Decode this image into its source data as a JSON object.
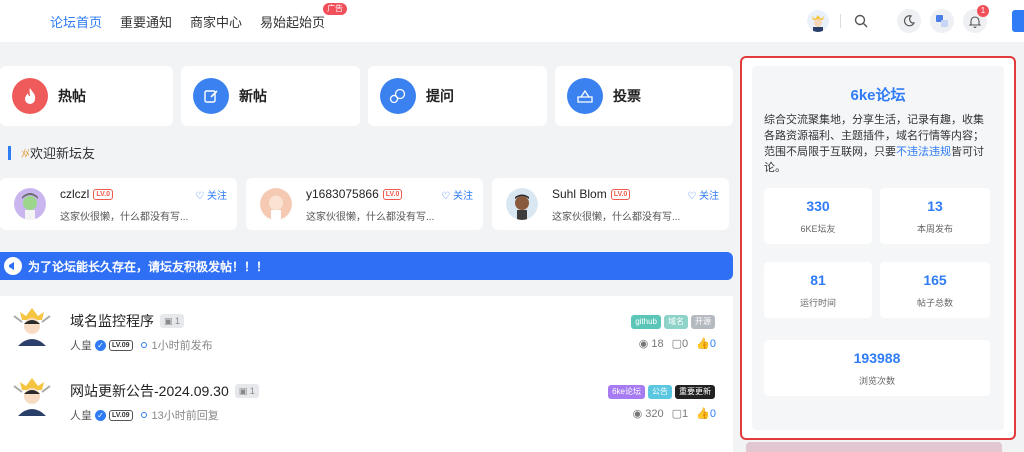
{
  "nav": {
    "items": [
      {
        "label": "论坛首页",
        "active": true
      },
      {
        "label": "重要通知",
        "active": false
      },
      {
        "label": "商家中心",
        "active": false
      },
      {
        "label": "易始起始页",
        "active": false
      }
    ],
    "ad_badge": "广告"
  },
  "header": {
    "icons": [
      "search-icon",
      "moon-icon",
      "translate-icon",
      "bell-icon"
    ],
    "bell_count": "1"
  },
  "quick_actions": [
    {
      "label": "热帖",
      "icon": "fire-icon",
      "color": "#ef5a5a"
    },
    {
      "label": "新帖",
      "icon": "edit-icon",
      "color": "#3b82f0"
    },
    {
      "label": "提问",
      "icon": "question-icon",
      "color": "#3b82f0"
    },
    {
      "label": "投票",
      "icon": "vote-icon",
      "color": "#3b82f0"
    }
  ],
  "welcome": {
    "title": "欢迎新坛友",
    "members": [
      {
        "name": "czlczl",
        "level": "LV.0",
        "bio": "这家伙很懒，什么都没有写...",
        "follow": "关注"
      },
      {
        "name": "y1683075866",
        "level": "LV.0",
        "bio": "这家伙很懒，什么都没有写...",
        "follow": "关注"
      },
      {
        "name": "Suhl Blom",
        "level": "LV.0",
        "bio": "这家伙很懒，什么都没有写...",
        "follow": "关注"
      }
    ]
  },
  "notice": {
    "text": "为了论坛能长久存在，请坛友积极发帖！！！"
  },
  "posts": [
    {
      "title": "域名监控程序",
      "img_count": "1",
      "author": "人皇",
      "level": "LV.09",
      "time": "1小时前发布",
      "tags": [
        {
          "label": "github",
          "color": "#5bc6b7"
        },
        {
          "label": "域名",
          "color": "#8dd3c7"
        },
        {
          "label": "开源",
          "color": "#b5b9c0"
        }
      ],
      "views": "18",
      "comments": "0",
      "likes": "0"
    },
    {
      "title": "网站更新公告-2024.09.30",
      "img_count": "1",
      "author": "人皇",
      "level": "LV.09",
      "time": "13小时前回复",
      "tags": [
        {
          "label": "6ke论坛",
          "color": "#a77cf2"
        },
        {
          "label": "公告",
          "color": "#5bc6e0"
        },
        {
          "label": "重要更新",
          "color": "#222222"
        }
      ],
      "views": "320",
      "comments": "1",
      "likes": "0"
    }
  ],
  "sidebar": {
    "title": "6ke论坛",
    "desc_main": "综合交流聚集地，分享生活，记录有趣，收集各路资源福利、主题插件，域名行情等内容；范围不局限于互联网，只要",
    "desc_link": "不违法违规",
    "desc_end": "皆可讨论。",
    "stats": [
      {
        "value": "330",
        "label": "6KE坛友"
      },
      {
        "value": "13",
        "label": "本周发布"
      },
      {
        "value": "81",
        "label": "运行时间"
      },
      {
        "value": "165",
        "label": "帖子总数"
      },
      {
        "value": "193988",
        "label": "浏览次数"
      }
    ]
  }
}
